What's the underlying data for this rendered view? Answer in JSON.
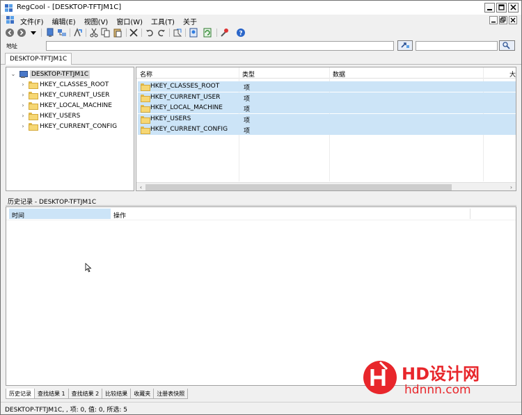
{
  "window": {
    "title": "RegCool - [DESKTOP-TFTJM1C]"
  },
  "menu": {
    "items": [
      "文件(F)",
      "编辑(E)",
      "视图(V)",
      "窗口(W)",
      "工具(T)",
      "关于"
    ]
  },
  "toolbar": {
    "icons": [
      "back-icon",
      "forward-icon",
      "dropdown-arrow-icon",
      "connect-icon",
      "network-icon",
      "export-icon",
      "cut-icon",
      "copy-icon",
      "paste-icon",
      "delete-icon",
      "undo-icon",
      "redo-icon",
      "find-icon",
      "bookmark-icon",
      "refresh-icon",
      "tools-icon",
      "help-icon"
    ]
  },
  "address": {
    "label": "地址",
    "value": ""
  },
  "doc_tab": {
    "label": "DESKTOP-TFTJM1C"
  },
  "tree": {
    "root": "DESKTOP-TFTJM1C",
    "items": [
      "HKEY_CLASSES_ROOT",
      "HKEY_CURRENT_USER",
      "HKEY_LOCAL_MACHINE",
      "HKEY_USERS",
      "HKEY_CURRENT_CONFIG"
    ]
  },
  "list": {
    "columns": [
      "名称",
      "类型",
      "数据",
      "大"
    ],
    "rows": [
      {
        "name": "HKEY_CLASSES_ROOT",
        "type": "项"
      },
      {
        "name": "HKEY_CURRENT_USER",
        "type": "项"
      },
      {
        "name": "HKEY_LOCAL_MACHINE",
        "type": "项"
      },
      {
        "name": "HKEY_USERS",
        "type": "项"
      },
      {
        "name": "HKEY_CURRENT_CONFIG",
        "type": "项"
      }
    ]
  },
  "history": {
    "title": "历史记录 - DESKTOP-TFTJM1C",
    "columns": [
      "时间",
      "操作"
    ]
  },
  "bottom_tabs": [
    "历史记录",
    "查找结果 1",
    "查找结果 2",
    "比较结果",
    "收藏夹",
    "注册表快照"
  ],
  "status": {
    "text": "DESKTOP-TFTJM1C, , 项: 0, 值: 0, 所选: 5"
  },
  "watermark": {
    "brand": "HD设计网",
    "url": "hdnnn.com"
  },
  "colors": {
    "selection": "#cce4f7",
    "folder": "#f6d774",
    "watermark_red": "#e8262b"
  }
}
